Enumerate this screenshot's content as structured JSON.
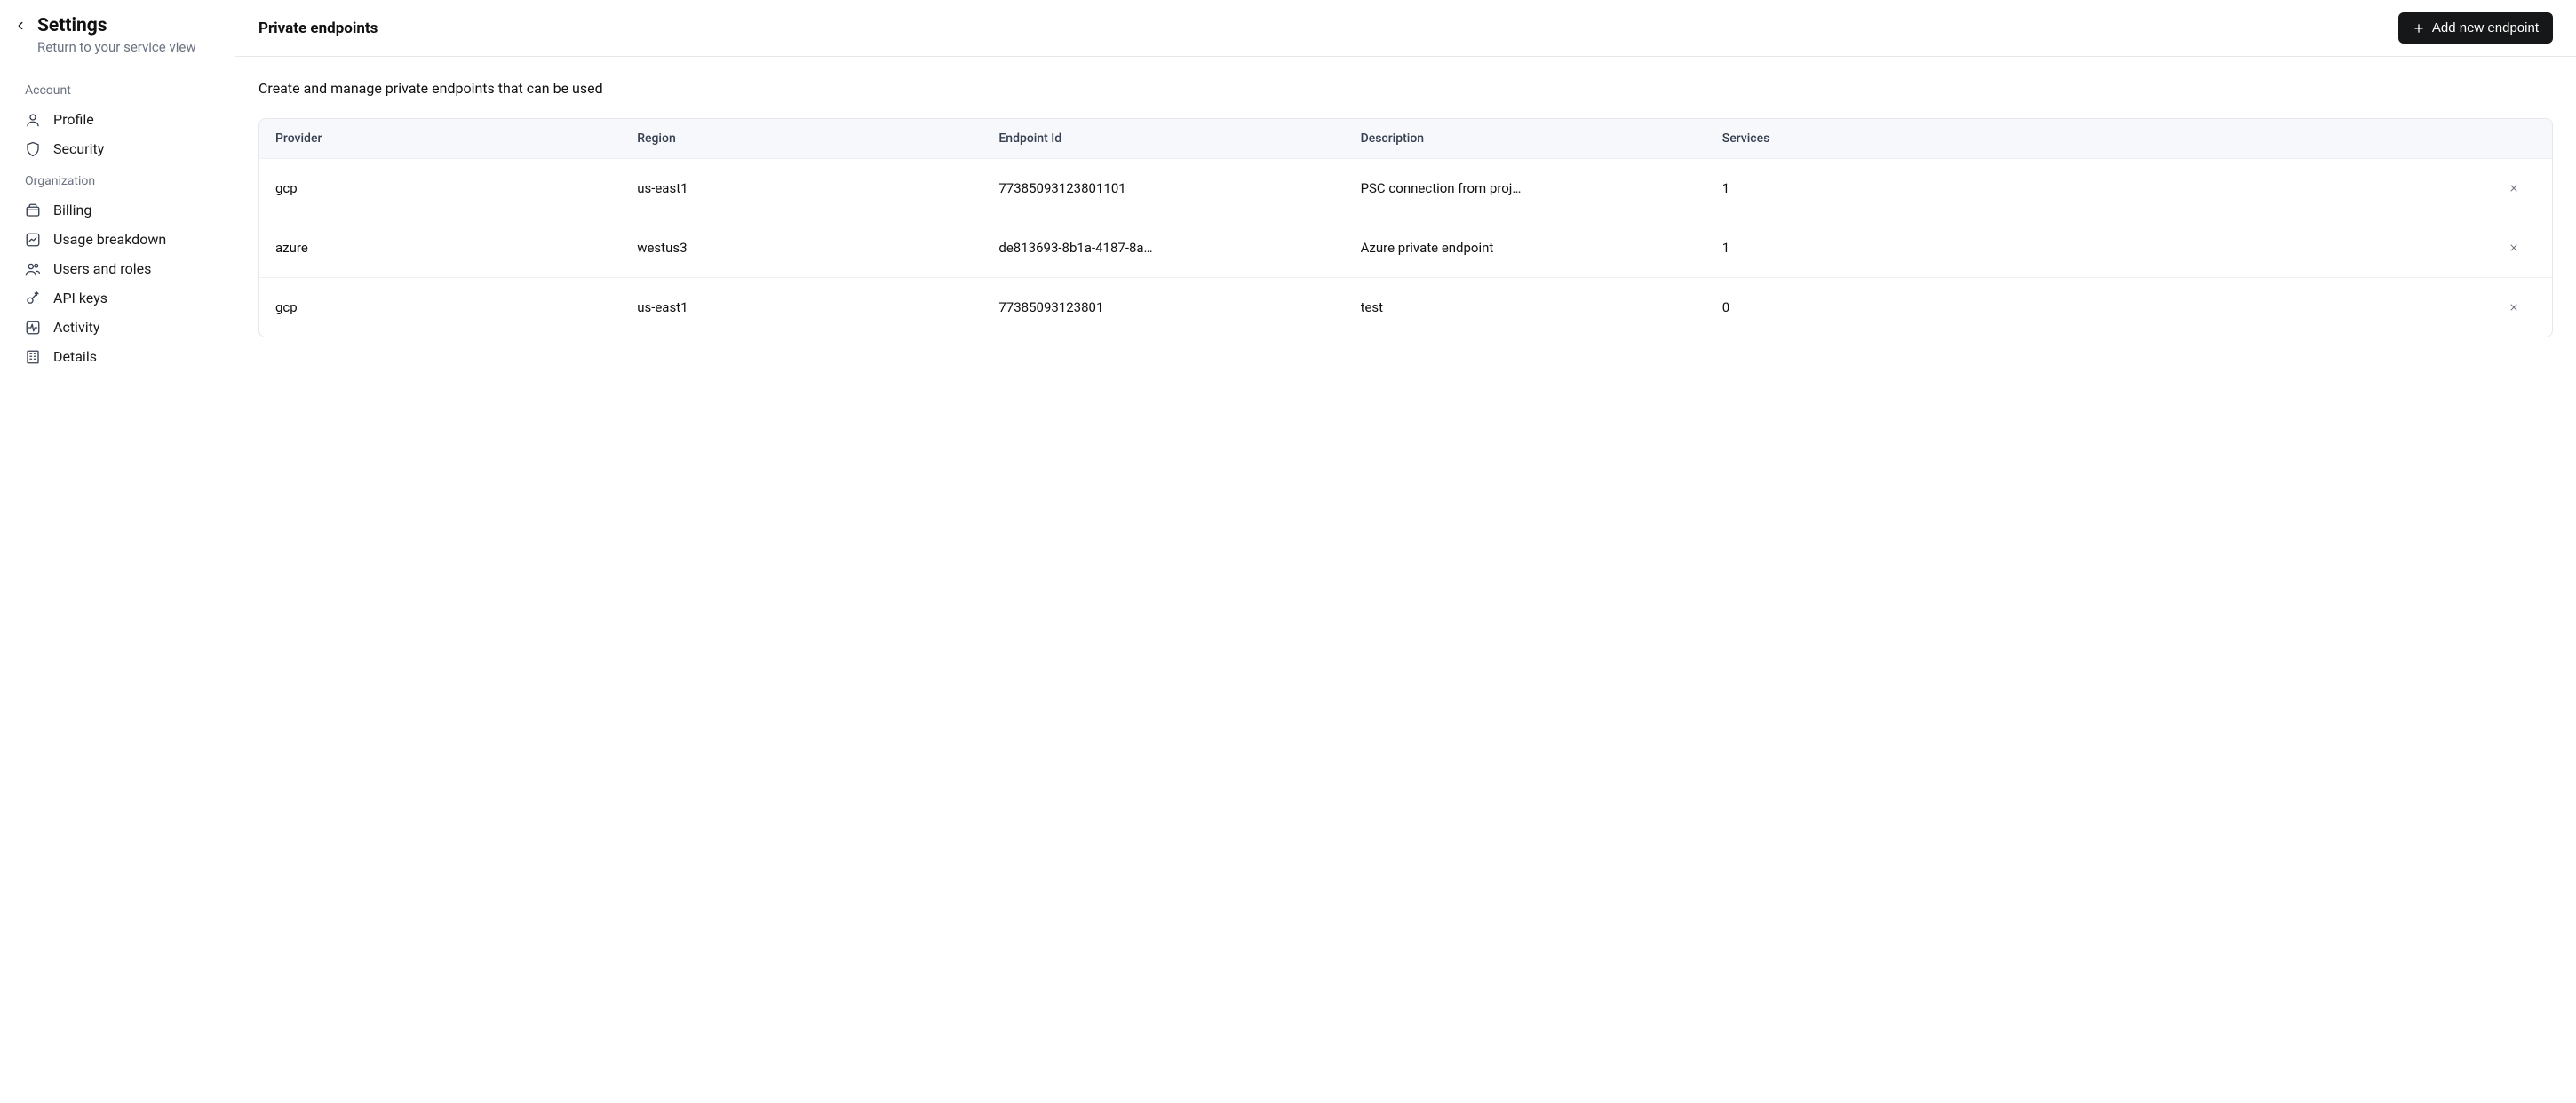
{
  "sidebar": {
    "title": "Settings",
    "subtitle": "Return to your service view",
    "sections": {
      "account": {
        "label": "Account",
        "items": [
          {
            "label": "Profile",
            "icon": "user-icon"
          },
          {
            "label": "Security",
            "icon": "shield-icon"
          }
        ]
      },
      "organization": {
        "label": "Organization",
        "items": [
          {
            "label": "Billing",
            "icon": "wallet-icon"
          },
          {
            "label": "Usage breakdown",
            "icon": "chart-icon"
          },
          {
            "label": "Users and roles",
            "icon": "users-icon"
          },
          {
            "label": "API keys",
            "icon": "key-icon"
          },
          {
            "label": "Activity",
            "icon": "activity-icon"
          },
          {
            "label": "Details",
            "icon": "building-icon"
          }
        ]
      }
    }
  },
  "header": {
    "title": "Private endpoints",
    "add_button": "Add new endpoint"
  },
  "page": {
    "description": "Create and manage private endpoints that can be used"
  },
  "table": {
    "columns": {
      "provider": "Provider",
      "region": "Region",
      "endpoint_id": "Endpoint Id",
      "description": "Description",
      "services": "Services"
    },
    "rows": [
      {
        "provider": "gcp",
        "region": "us-east1",
        "endpoint_id": "77385093123801101",
        "description": "PSC connection from proj…",
        "services": "1"
      },
      {
        "provider": "azure",
        "region": "westus3",
        "endpoint_id": "de813693-8b1a-4187-8a…",
        "description": "Azure private endpoint",
        "services": "1"
      },
      {
        "provider": "gcp",
        "region": "us-east1",
        "endpoint_id": "77385093123801",
        "description": "test",
        "services": "0"
      }
    ]
  }
}
